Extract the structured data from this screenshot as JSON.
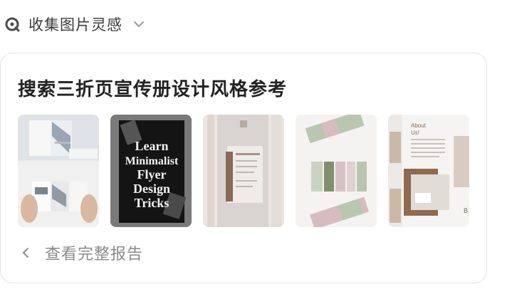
{
  "header": {
    "title": "收集图片灵感"
  },
  "card": {
    "title": "搜索三折页宣传册设计风格参考",
    "thumb2_text": [
      "Learn",
      "Minimalist",
      "Flyer",
      "Design",
      "Tricks"
    ],
    "thumb5_text": {
      "line1": "About",
      "line2": "Us!",
      "letter": "B"
    },
    "footer_text": "查看完整报告"
  }
}
